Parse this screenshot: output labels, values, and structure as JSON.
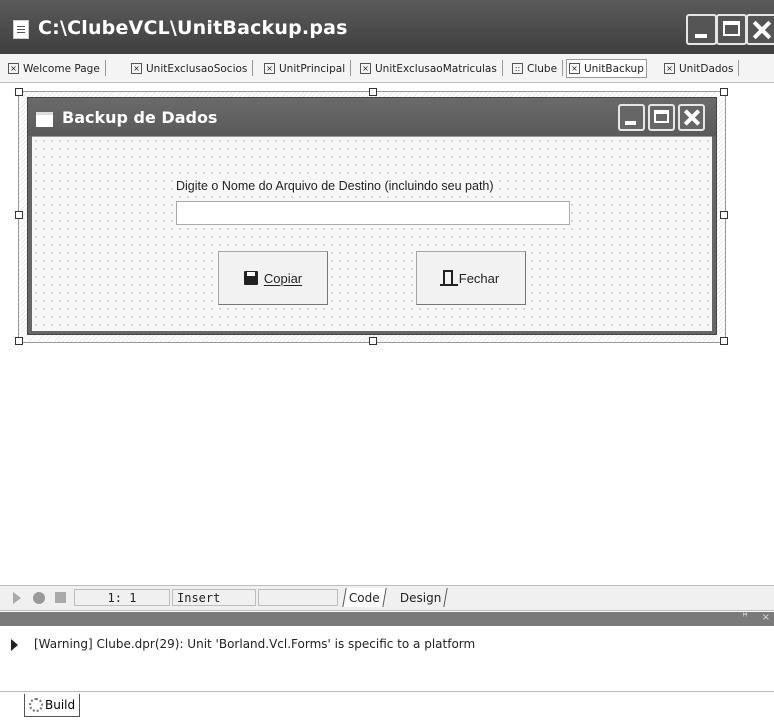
{
  "window": {
    "title": "C:\\ClubeVCL\\UnitBackup.pas"
  },
  "tabs": [
    {
      "label": "Welcome Page"
    },
    {
      "label": "UnitExclusaoSocios"
    },
    {
      "label": "UnitPrincipal"
    },
    {
      "label": "UnitExclusaoMatriculas"
    },
    {
      "label": "Clube"
    },
    {
      "label": "UnitBackup"
    },
    {
      "label": "UnitDados"
    }
  ],
  "form": {
    "title": "Backup de Dados",
    "prompt_label": "Digite o Nome do Arquivo de Destino (incluindo seu path)",
    "filename_value": "",
    "copy_label": "Copiar",
    "close_label": "Fechar"
  },
  "status": {
    "position": "1:  1",
    "mode": "Insert",
    "code_tab": "Code",
    "design_tab": "Design"
  },
  "messages": [
    {
      "text": "[Warning] Clube.dpr(29): Unit 'Borland.Vcl.Forms' is specific to a platform"
    }
  ],
  "bottom": {
    "build_tab": "Build"
  },
  "icons": {
    "doc": "document-icon",
    "save": "floppy-icon",
    "exit": "door-exit-icon",
    "build": "gear-icon"
  }
}
